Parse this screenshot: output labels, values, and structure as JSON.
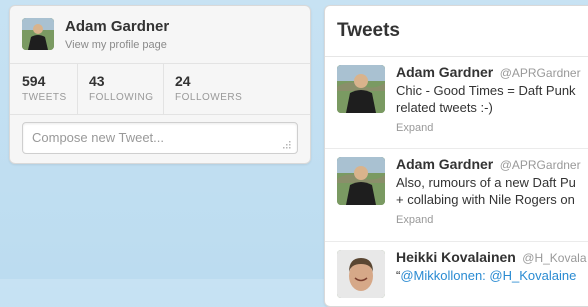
{
  "profile": {
    "name": "Adam Gardner",
    "link_label": "View my profile page",
    "stats": [
      {
        "count": "594",
        "label": "TWEETS"
      },
      {
        "count": "43",
        "label": "FOLLOWING"
      },
      {
        "count": "24",
        "label": "FOLLOWERS"
      }
    ],
    "compose_placeholder": "Compose new Tweet..."
  },
  "tweets_panel": {
    "title": "Tweets",
    "tweets": [
      {
        "name": "Adam Gardner",
        "handle": "@APRGardner",
        "text": "Chic - Good Times = Daft Punk\nrelated tweets :-)",
        "expand": "Expand"
      },
      {
        "name": "Adam Gardner",
        "handle": "@APRGardner",
        "text": "Also, rumours of a new Daft Pu\n+ collabing with Nile Rogers on",
        "expand": "Expand"
      },
      {
        "name": "Heikki Kovalainen",
        "handle": "@H_Kovala",
        "text_prefix": "“",
        "mention": "@Mikkollonen: @H_Kovalaine"
      }
    ]
  },
  "colors": {
    "background": "#c7e2f3",
    "link": "#2a8bd2"
  }
}
